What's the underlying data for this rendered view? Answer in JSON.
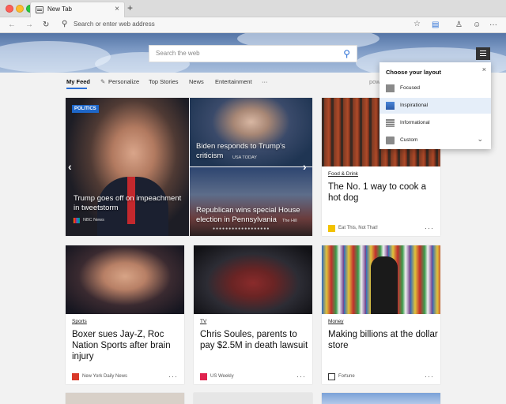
{
  "browser": {
    "tab_title": "New Tab",
    "new_tab": "+",
    "address_placeholder": "Search or enter web address"
  },
  "hero": {
    "search_placeholder": "Search the web"
  },
  "nav": {
    "items": [
      "My Feed",
      "Personalize",
      "Top Stories",
      "News",
      "Entertainment",
      "···"
    ],
    "powered": "pow"
  },
  "layout_popup": {
    "title": "Choose your layout",
    "options": [
      "Focused",
      "Inspirational",
      "Informational",
      "Custom"
    ],
    "selected": "Inspirational"
  },
  "carousel": {
    "badge": "POLITICS",
    "main": {
      "headline": "Trump goes off on impeachment in tweetstorm",
      "source": "NBC News"
    },
    "top_right": {
      "headline": "Biden responds to Trump's criticism",
      "source": "USA TODAY"
    },
    "bottom_right": {
      "headline": "Republican wins special House election in Pennsylvania",
      "source": "The Hill"
    },
    "dots": "●●●●●●●●●●●●●●●●●●"
  },
  "cards": [
    {
      "category": "Food & Drink",
      "headline": "The No. 1 way to cook a hot dog",
      "source": "Eat This, Not That!"
    },
    {
      "category": "Sports",
      "headline": "Boxer sues Jay-Z, Roc Nation Sports after brain injury",
      "source": "New York Daily News"
    },
    {
      "category": "TV",
      "headline": "Chris Soules, parents to pay $2.5M in death lawsuit",
      "source": "US Weekly"
    },
    {
      "category": "Money",
      "headline": "Making billions at the dollar store",
      "source": "Fortune"
    }
  ],
  "more": "···",
  "colors": {
    "accent": "#2a6fd6",
    "badge": "#1e67c9"
  }
}
